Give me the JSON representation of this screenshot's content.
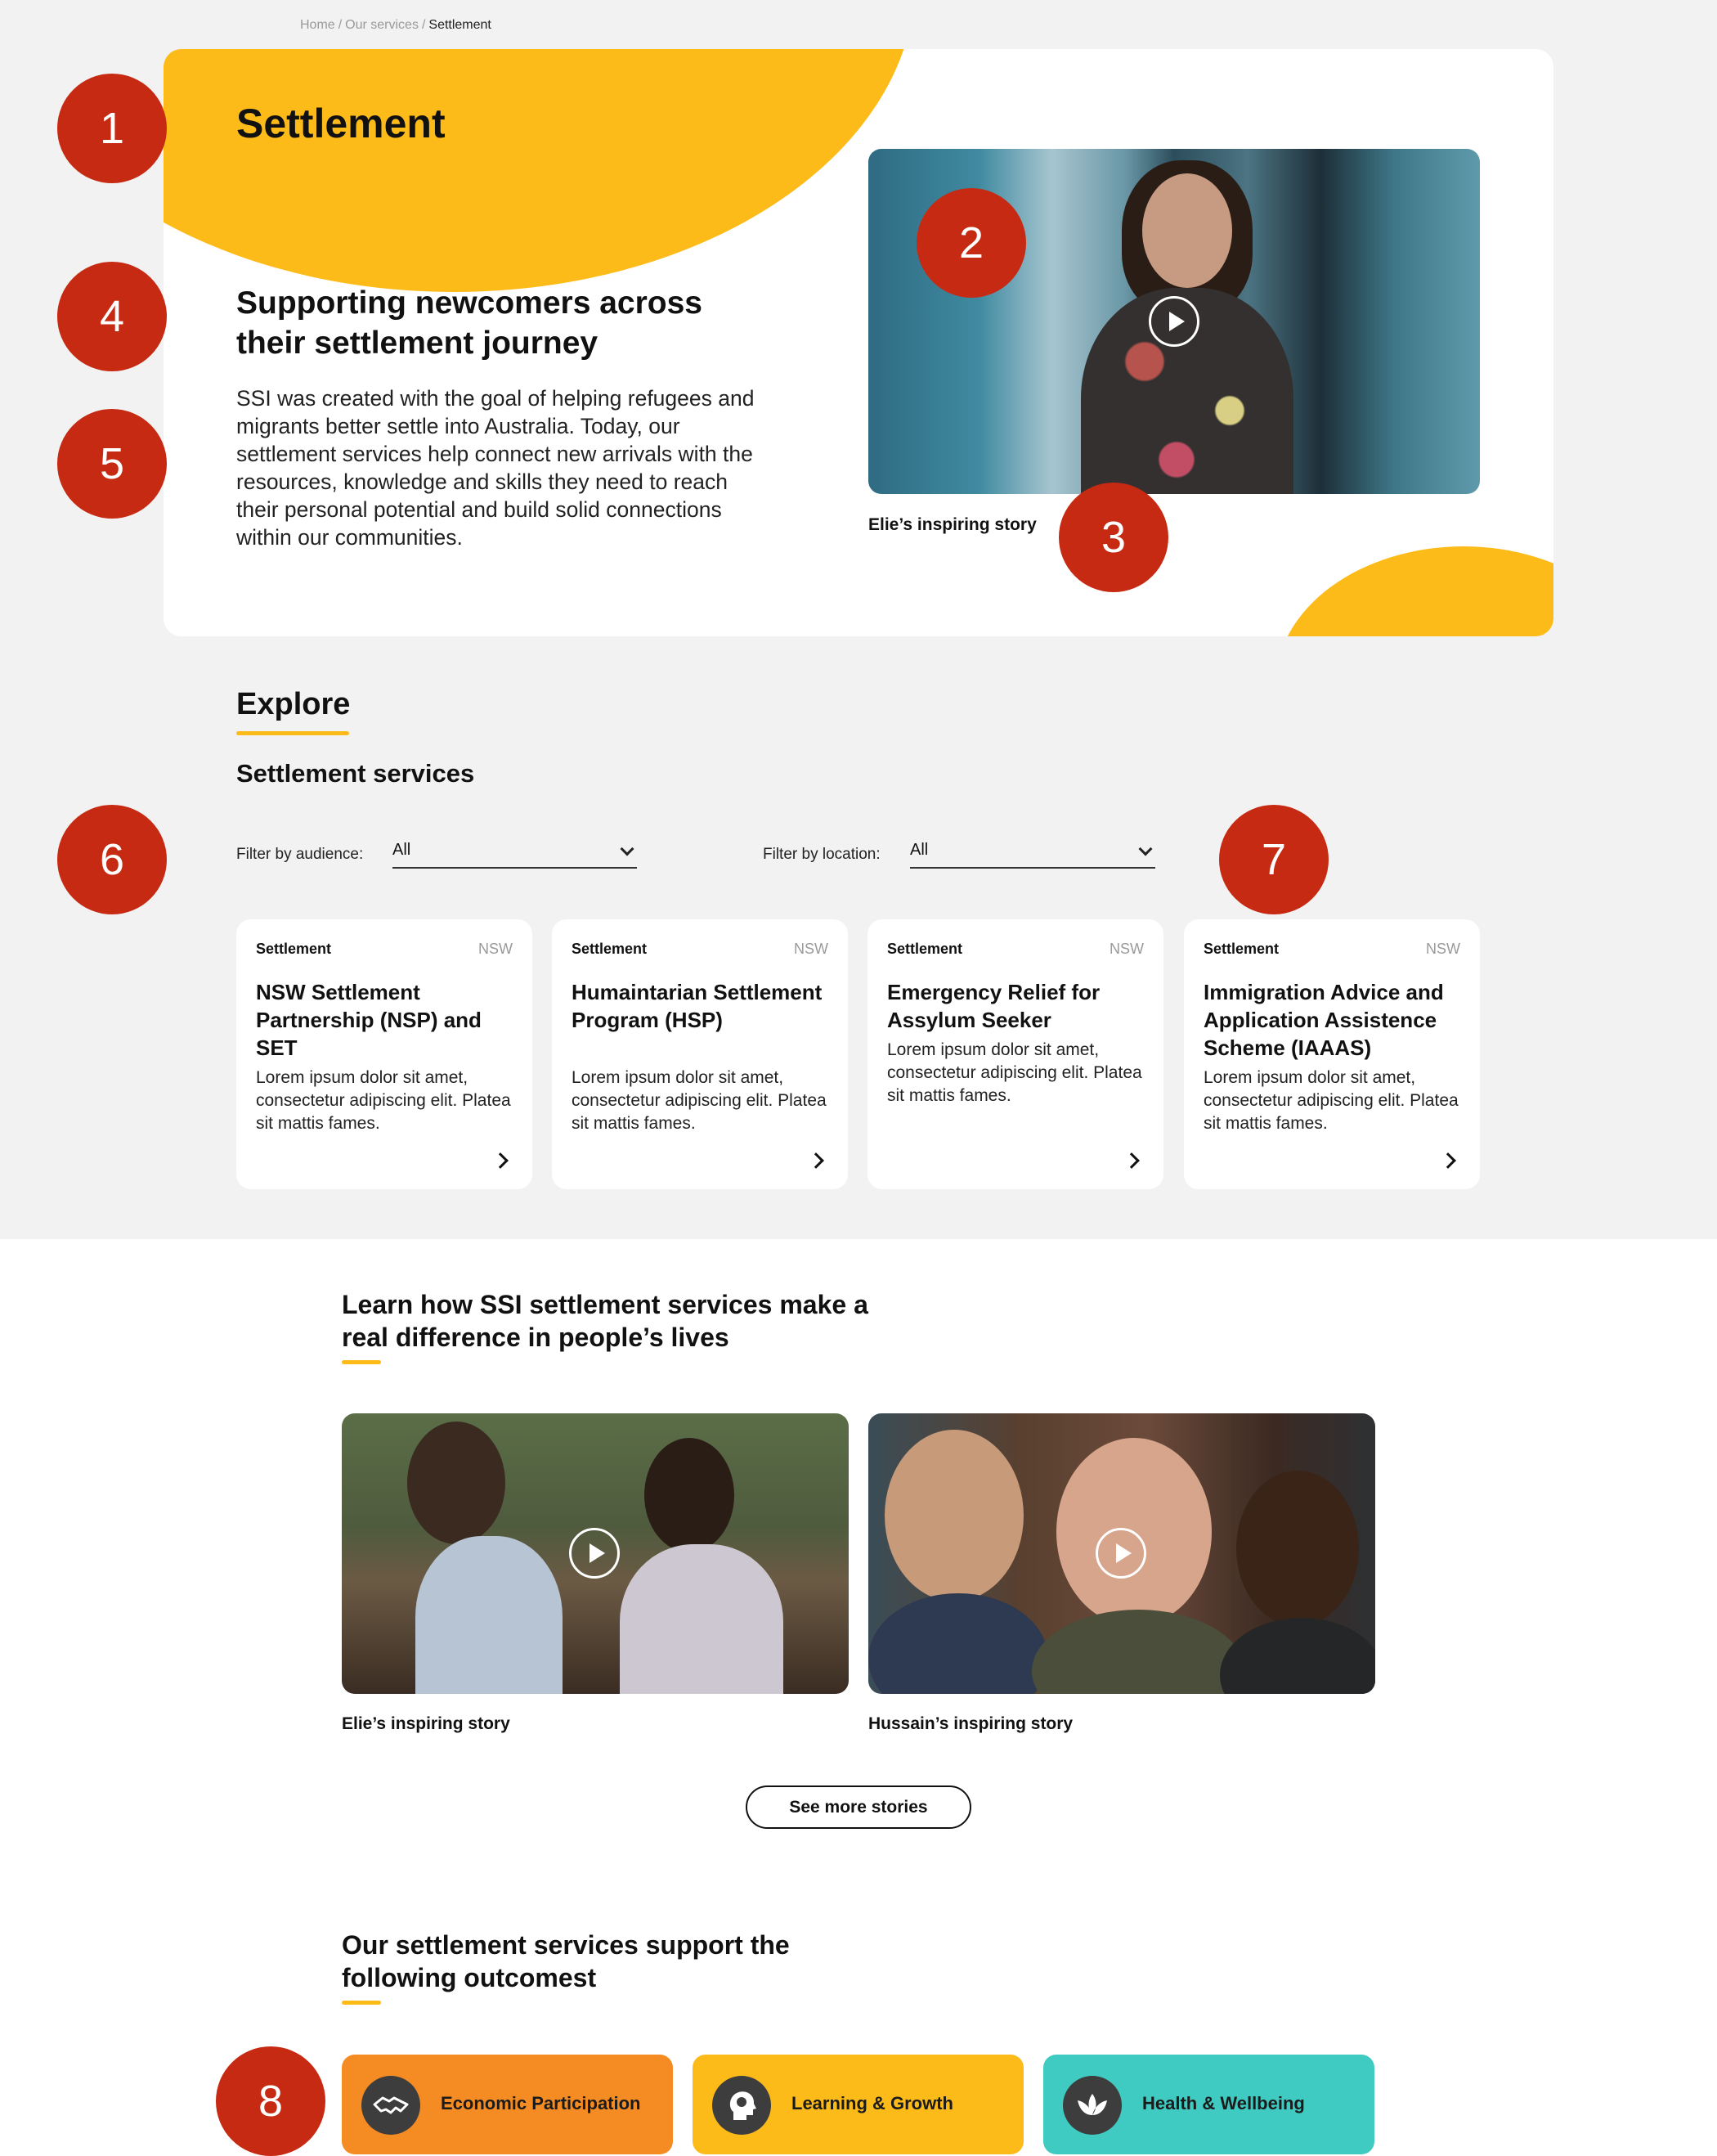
{
  "breadcrumb": {
    "home": "Home",
    "services": "Our services",
    "current": "Settlement",
    "sep": "/"
  },
  "hero": {
    "title": "Settlement",
    "heading": "Supporting newcomers across their settlement journey",
    "text": "SSI was created with the goal of helping refugees and migrants better settle into Australia. Today, our settlement services help connect new arrivals with the resources, knowledge and skills they need to reach their personal potential and build solid connections within our communities.",
    "video_caption": "Elie’s inspiring story"
  },
  "markers": [
    "1",
    "2",
    "3",
    "4",
    "5",
    "6",
    "7",
    "8"
  ],
  "explore": {
    "title": "Explore",
    "services_title": "Settlement services",
    "filter_audience_label": "Filter by audience:",
    "filter_audience_value": "All",
    "filter_location_label": "Filter by location:",
    "filter_location_value": "All"
  },
  "cards": [
    {
      "category": "Settlement",
      "location": "NSW",
      "title": "NSW Settlement Partnership (NSP) and SET",
      "desc": "Lorem ipsum dolor sit amet, consectetur adipiscing elit. Platea sit mattis fames."
    },
    {
      "category": "Settlement",
      "location": "NSW",
      "title": "Humaintarian Settlement Program (HSP)",
      "desc": "Lorem ipsum dolor sit amet, consectetur adipiscing elit. Platea sit mattis fames."
    },
    {
      "category": "Settlement",
      "location": "NSW",
      "title": "Emergency Relief for Assylum Seeker",
      "desc": "Lorem ipsum dolor sit amet, consectetur adipiscing elit. Platea sit mattis fames."
    },
    {
      "category": "Settlement",
      "location": "NSW",
      "title": "Immigration Advice and Application Assistence Scheme (IAAAS)",
      "desc": "Lorem ipsum dolor sit amet, consectetur adipiscing elit. Platea sit mattis fames."
    }
  ],
  "stories": {
    "title": "Learn how SSI settlement services make a real difference in people’s lives",
    "items": [
      {
        "caption": "Elie’s inspiring story"
      },
      {
        "caption": "Hussain’s inspiring story"
      }
    ],
    "more_label": "See more stories"
  },
  "outcomes": {
    "title": "Our settlement services support the following outcomest",
    "items": [
      {
        "label": "Economic Participation",
        "color": "#f48c23",
        "icon": "handshake-icon"
      },
      {
        "label": "Learning & Growth",
        "color": "#fdbb1a",
        "icon": "idea-head-icon"
      },
      {
        "label": "Health & Wellbeing",
        "color": "#3fcbc1",
        "icon": "lotus-icon"
      }
    ]
  }
}
